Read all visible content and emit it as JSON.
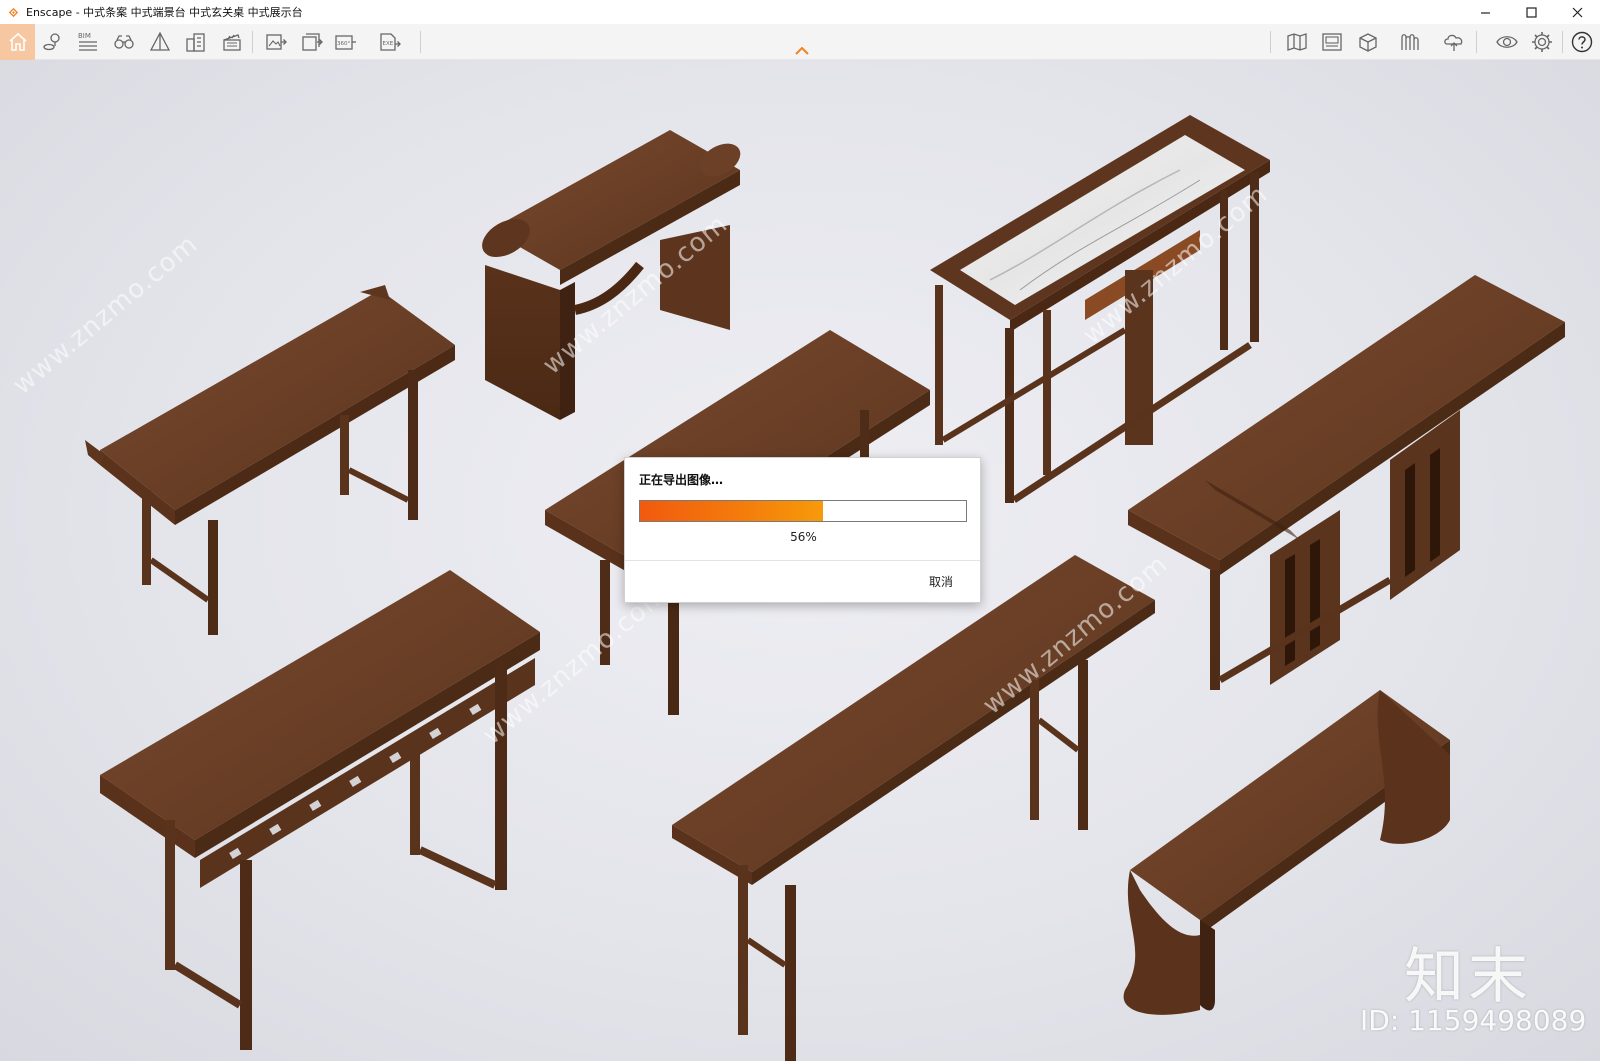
{
  "window": {
    "title": "Enscape - 中式条案 中式端景台 中式玄关桌 中式展示台"
  },
  "toolbar": {
    "bim_label": "BIM",
    "pano_label": "360°",
    "exe_label": "EXE",
    "left_icons": [
      "home-icon",
      "map-pin-icon",
      "bim-icon",
      "binoculars-icon",
      "pyramid-icon",
      "buildings-icon",
      "clapper-icon",
      "render-image-icon",
      "batch-render-icon",
      "panorama-icon",
      "standalone-export-icon"
    ],
    "right_icons": [
      "map-icon",
      "views-manager-icon",
      "asset-library-icon",
      "material-editor-icon",
      "upload-icon",
      "visual-settings-icon",
      "settings-icon",
      "help-icon"
    ]
  },
  "dialog": {
    "title": "正在导出图像…",
    "progress": 0.56,
    "progress_text": "56%",
    "cancel_label": "取消"
  },
  "watermark": {
    "site": "www.znzmo.com",
    "brand": "知末",
    "id_text": "ID: 1159498089"
  },
  "colors": {
    "accent": "#f15a0f",
    "home_active": "#f7c7a2",
    "wood": "#6b4128"
  }
}
